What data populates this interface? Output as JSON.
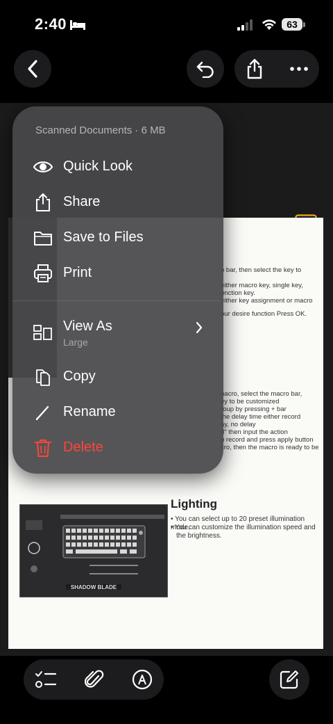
{
  "status_bar": {
    "time": "2:40",
    "battery": "63"
  },
  "menu": {
    "header": "Scanned Documents · 6 MB",
    "items": [
      {
        "label": "Quick Look",
        "icon": "eye-icon"
      },
      {
        "label": "Share",
        "icon": "share-icon"
      },
      {
        "label": "Save to Files",
        "icon": "folder-icon"
      },
      {
        "label": "Print",
        "icon": "printer-icon"
      },
      {
        "label": "View As",
        "sublabel": "Large",
        "icon": "view-as-icon"
      },
      {
        "label": "Copy",
        "icon": "copy-icon"
      },
      {
        "label": "Rename",
        "icon": "pencil-icon"
      },
      {
        "label": "Delete",
        "icon": "trash-icon"
      }
    ]
  },
  "document": {
    "lines_top": [
      "o bar, then select the key to",
      "either macro key, single key,",
      "unction key.",
      "either key assignment or macro",
      "our desire function Press OK."
    ],
    "lines_mid": [
      "nacro, select the macro bar,",
      "ey to be customized",
      "roup by pressing + bar",
      "the delay time either record",
      "ay, no delay",
      "d\" then input the action",
      "p record and press apply button",
      "cro, then the macro is ready to be"
    ],
    "lighting_title": "Lighting",
    "lighting_bullets": [
      "• You can select up to 20 preset illumination mode.",
      "• You can customize the illumination speed and",
      "  the brightness."
    ],
    "image_caption": "SHADOW BLADE"
  },
  "colors": {
    "accent": "#f0a626",
    "delete": "#ff453a",
    "menu_bg": "#48484a"
  }
}
